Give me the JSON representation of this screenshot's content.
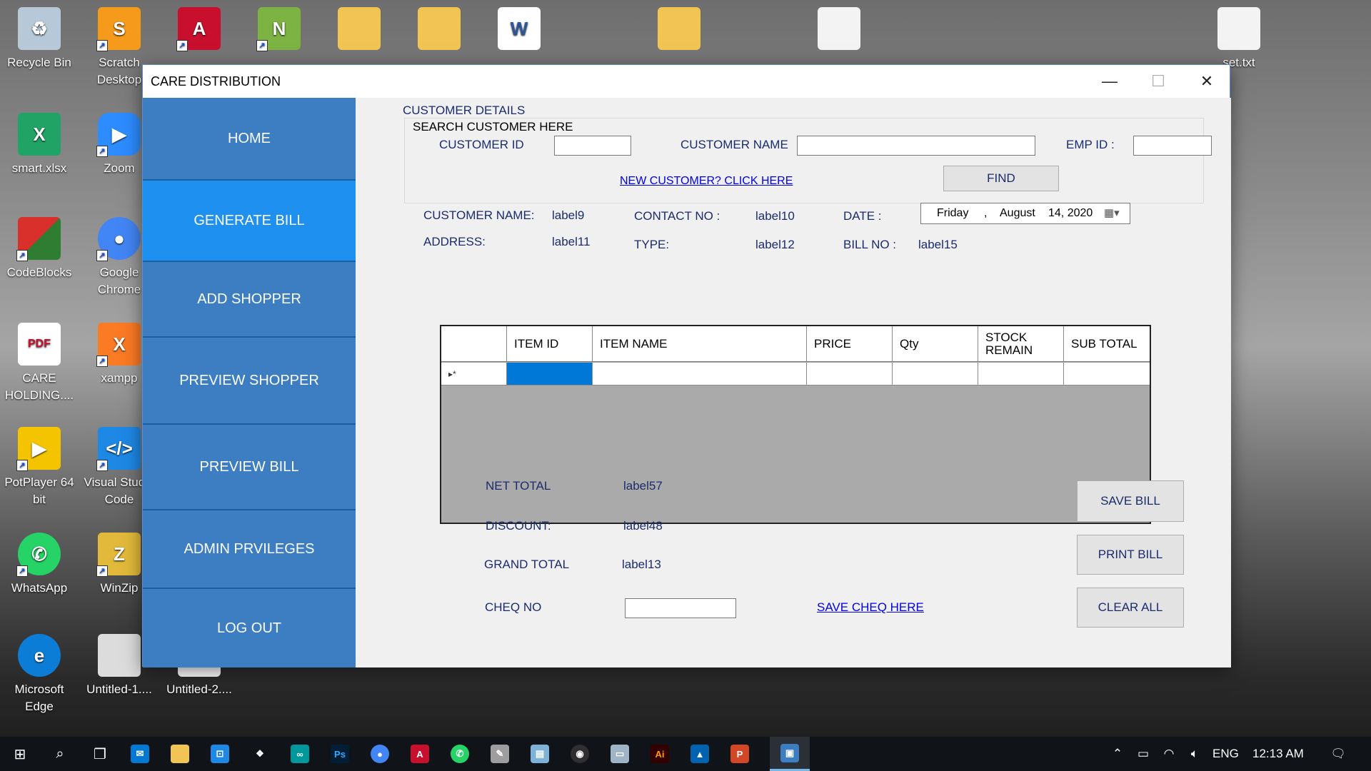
{
  "desktop": {
    "icons": [
      {
        "label": "Recycle Bin",
        "icon": "recycle-bin-icon",
        "color": "#7fa7c9"
      },
      {
        "label": "Scratch Desktop",
        "icon": "scratch-icon",
        "color": "#f59a1b"
      },
      {
        "label": "",
        "icon": "acrobat-icon",
        "color": "#c8102e"
      },
      {
        "label": "",
        "icon": "notepad-plus-icon",
        "color": "#7cb342"
      },
      {
        "label": "",
        "icon": "folder-icon",
        "color": "#f2c453"
      },
      {
        "label": "",
        "icon": "folder-icon",
        "color": "#f2c453"
      },
      {
        "label": "",
        "icon": "word-doc-icon",
        "color": "#2b579a"
      },
      {
        "label": "",
        "icon": "folder-icon",
        "color": "#f2c453"
      },
      {
        "label": "",
        "icon": "text-file-icon",
        "color": "#f3f3f3"
      },
      {
        "label": "set.txt",
        "icon": "text-file-icon",
        "color": "#f3f3f3"
      },
      {
        "label": "smart.xlsx",
        "icon": "excel-icon",
        "color": "#21a366"
      },
      {
        "label": "Zoom",
        "icon": "zoom-icon",
        "color": "#2d8cff"
      },
      {
        "label": "CodeBlocks",
        "icon": "codeblocks-icon",
        "color": "#d9302c"
      },
      {
        "label": "Google Chrome",
        "icon": "chrome-icon",
        "color": "#4285f4"
      },
      {
        "label": "CARE HOLDING....",
        "icon": "pdf-icon",
        "color": "#ffffff"
      },
      {
        "label": "xampp",
        "icon": "xampp-icon",
        "color": "#fb7a24"
      },
      {
        "label": "PotPlayer 64 bit",
        "icon": "potplayer-icon",
        "color": "#f5c400"
      },
      {
        "label": "Visual Studio Code",
        "icon": "vscode-icon",
        "color": "#1e88e5"
      },
      {
        "label": "WhatsApp",
        "icon": "whatsapp-icon",
        "color": "#25d366"
      },
      {
        "label": "WinZip",
        "icon": "winzip-icon",
        "color": "#e2b93b"
      },
      {
        "label": "Microsoft Edge",
        "icon": "edge-icon",
        "color": "#0c7dd6"
      },
      {
        "label": "Untitled-1....",
        "icon": "image-file-icon",
        "color": "#dcdcdc"
      },
      {
        "label": "Untitled-2....",
        "icon": "image-file-icon",
        "color": "#ffffff"
      }
    ]
  },
  "window": {
    "title": "CARE DISTRIBUTION",
    "minimize": "—",
    "maximize": "☐",
    "close": "✕"
  },
  "sidebar": {
    "items": [
      {
        "label": "HOME",
        "active": false
      },
      {
        "label": "GENERATE BILL",
        "active": true
      },
      {
        "label": "ADD SHOPPER",
        "active": false
      },
      {
        "label": "PREVIEW SHOPPER",
        "active": false
      },
      {
        "label": "PREVIEW BILL",
        "active": false
      },
      {
        "label": "ADMIN PRVILEGES",
        "active": false
      },
      {
        "label": "LOG OUT",
        "active": false
      }
    ]
  },
  "customer": {
    "section_title": "CUSTOMER DETAILS",
    "search_title": "SEARCH CUSTOMER HERE",
    "id_label": "CUSTOMER ID",
    "id_value": "",
    "name_label": "CUSTOMER NAME",
    "name_value": "",
    "emp_label": "EMP ID :",
    "emp_value": "",
    "new_link": "NEW CUSTOMER? CLICK HERE",
    "find_button": "FIND"
  },
  "details": {
    "customer_name_label": "CUSTOMER NAME:",
    "customer_name_value": "label9",
    "contact_label": "CONTACT NO :",
    "contact_value": "label10",
    "date_label": "DATE :",
    "date_day": "Friday",
    "date_sep": ",",
    "date_month": "August",
    "date_rest": "14, 2020",
    "address_label": "ADDRESS:",
    "address_value": "label11",
    "type_label": "TYPE:",
    "type_value": "label12",
    "bill_label": "BILL NO :",
    "bill_value": "label15"
  },
  "grid": {
    "columns": [
      "",
      "ITEM ID",
      "ITEM NAME",
      "PRICE",
      "Qty",
      "STOCK REMAIN",
      "SUB TOTAL"
    ],
    "new_row_marker": "▸*"
  },
  "totals": {
    "net_label": "NET TOTAL",
    "net_value": "label57",
    "discount_label": "DISCOUNT:",
    "discount_value": "label48",
    "grand_label": "GRAND TOTAL",
    "grand_value": "label13",
    "cheq_label": "CHEQ NO",
    "cheq_value": "",
    "save_cheq_link": "SAVE CHEQ HERE"
  },
  "actions": {
    "save": "SAVE BILL",
    "print": "PRINT BILL",
    "clear": "CLEAR ALL"
  },
  "taskbar": {
    "apps": [
      "mail-icon",
      "file-explorer-icon",
      "store-icon",
      "dropbox-icon",
      "arduino-icon",
      "photoshop-icon",
      "chrome-icon",
      "acrobat-icon",
      "whatsapp-icon",
      "paint-icon",
      "notepad-icon",
      "obs-icon",
      "remote-desktop-icon",
      "illustrator-icon",
      "photos-icon",
      "powerpoint-icon",
      "app-window-icon"
    ],
    "language": "ENG",
    "time": "12:13 AM"
  },
  "colors": {
    "sidebar_bg": "#3d7ec2",
    "sidebar_active": "#1e90f0",
    "label_text": "#1c2b6b",
    "link": "#0000ee",
    "grid_selected": "#0078d7"
  }
}
